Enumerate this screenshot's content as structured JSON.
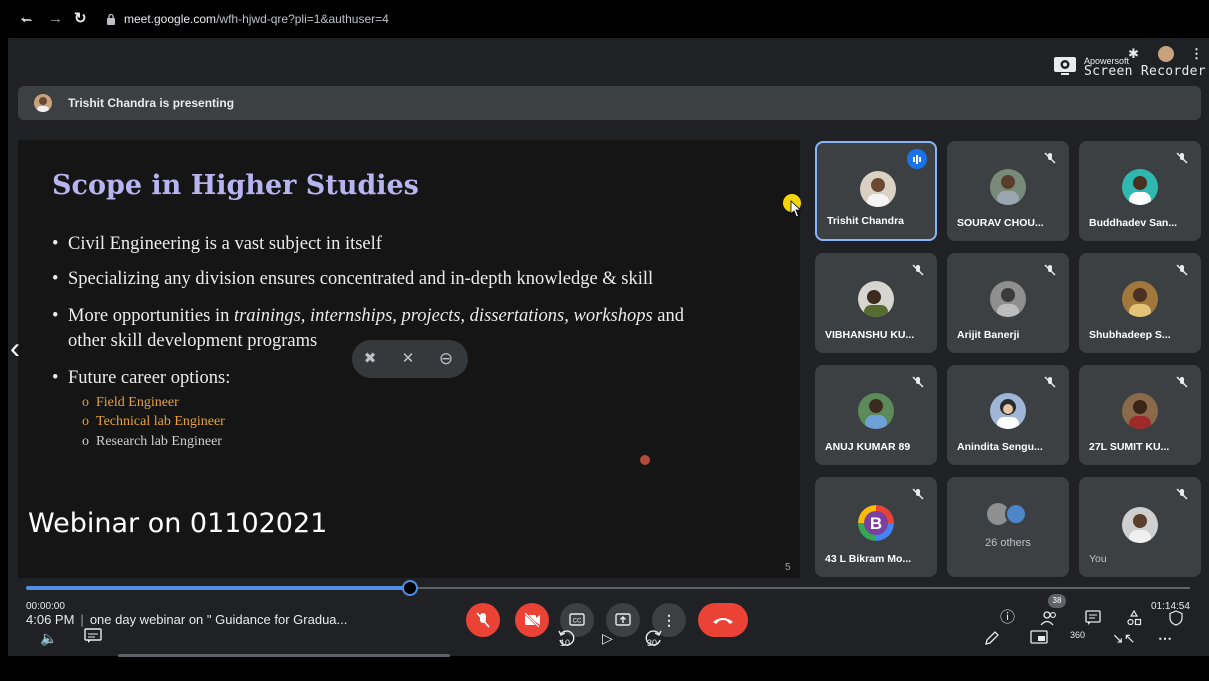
{
  "player": {
    "back_icon": "back-arrow-icon",
    "time_start": "00:00:00",
    "time_end": "01:14:54",
    "progress_fraction": 0.33,
    "skip_back": "10",
    "skip_forward": "30",
    "vr_label": "360"
  },
  "browser": {
    "url_domain": "meet.google.com",
    "url_path": "/wfh-hjwd-qre?pli=1&authuser=4",
    "recorder_brand": "Apowersoft",
    "recorder_title": "Screen Recorder"
  },
  "meet": {
    "presenting_text": "Trishit Chandra is presenting",
    "clock": "4:06 PM",
    "meeting_title": "one day webinar on \" Guidance for Gradua...",
    "participant_count": "38",
    "others_label": "26 others"
  },
  "slide": {
    "title": "Scope in Higher Studies",
    "bullets": {
      "b1": "Civil Engineering is a vast subject in itself",
      "b2": "Specializing any division ensures concentrated and in-depth knowledge & skill",
      "b3_pre": "More opportunities in ",
      "b3_em": "trainings, internships, projects, dissertations, workshops",
      "b3_post": " and",
      "b3_line2": "other skill development programs",
      "b4": "Future career options:"
    },
    "sub_bullets": {
      "s1": "Field Engineer",
      "s2": "Technical lab Engineer",
      "s3": "Research lab Engineer"
    },
    "overlay_label": "Webinar on 01102021",
    "page_number": "5",
    "colors": {
      "title": "#b8b4f0",
      "sub1": "#e6a23c",
      "sub2": "#e6a23c",
      "sub3": "#d0d0d0"
    }
  },
  "tiles": {
    "t1": "Trishit Chandra",
    "t2": "SOURAV CHOU...",
    "t3": "Buddhadev San...",
    "t4": "VIBHANSHU KU...",
    "t5": "Arijit Banerji",
    "t6": "Shubhadeep S...",
    "t7": "ANUJ KUMAR 89",
    "t8": "Anindita Sengu...",
    "t9": "27L SUMIT KU...",
    "t10": "43 L Bikram Mo...",
    "t12": "You"
  },
  "colors": {
    "accent_blue": "#8ab4f8",
    "end_call_red": "#ea4335",
    "surface": "#202124",
    "tile": "#3c4043"
  }
}
